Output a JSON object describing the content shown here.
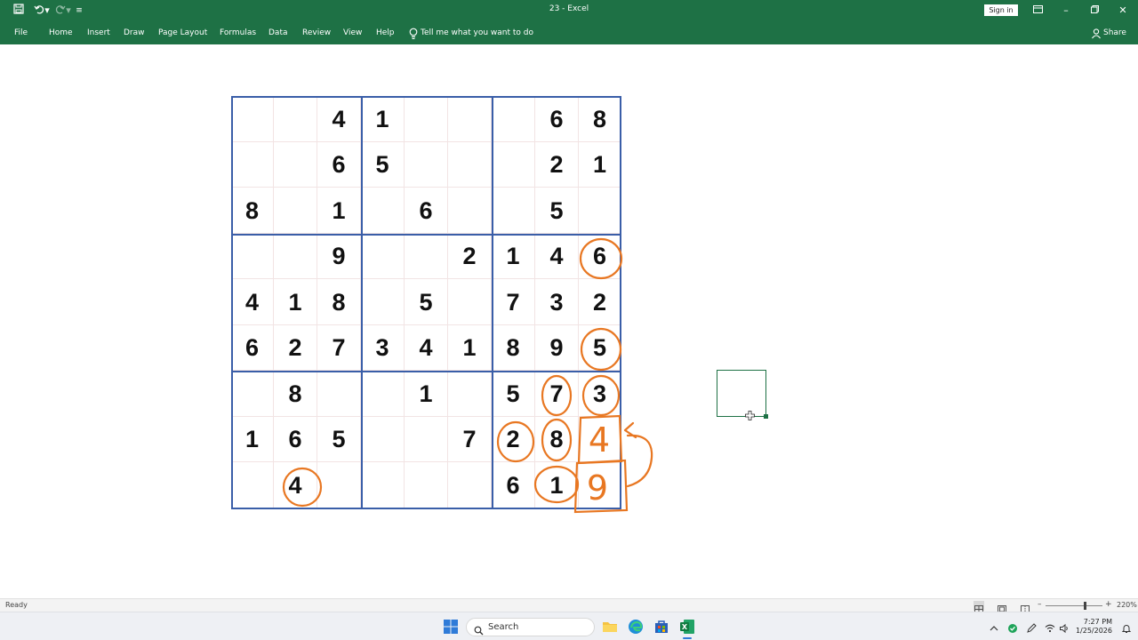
{
  "window": {
    "title": "23  -  Excel",
    "sign_in_label": "Sign in"
  },
  "ribbon": {
    "tabs": [
      "File",
      "Home",
      "Insert",
      "Draw",
      "Page Layout",
      "Formulas",
      "Data",
      "Review",
      "View",
      "Help"
    ],
    "tell_me": "Tell me what you want to do",
    "share": "Share"
  },
  "sudoku": {
    "rows": [
      [
        "",
        "",
        "4",
        "1",
        "",
        "",
        "",
        "6",
        "8"
      ],
      [
        "",
        "",
        "6",
        "5",
        "",
        "",
        "",
        "2",
        "1"
      ],
      [
        "8",
        "",
        "1",
        "",
        "6",
        "",
        "",
        "5",
        ""
      ],
      [
        "",
        "",
        "9",
        "",
        "",
        "2",
        "1",
        "4",
        "6"
      ],
      [
        "4",
        "1",
        "8",
        "",
        "5",
        "",
        "7",
        "3",
        "2"
      ],
      [
        "6",
        "2",
        "7",
        "3",
        "4",
        "1",
        "8",
        "9",
        "5"
      ],
      [
        "",
        "8",
        "",
        "",
        "1",
        "",
        "5",
        "7",
        "3"
      ],
      [
        "1",
        "6",
        "5",
        "",
        "",
        "7",
        "2",
        "8",
        ""
      ],
      [
        "",
        "4",
        "",
        "",
        "",
        "",
        "6",
        "1",
        ""
      ]
    ],
    "annotation_color": "#e87722",
    "handwritten": [
      "4",
      "9"
    ]
  },
  "status": {
    "ready": "Ready",
    "zoom": "220%"
  },
  "taskbar": {
    "search_label": "Search",
    "time": "7:27 PM",
    "date": "1/25/2026"
  },
  "colors": {
    "excel_green": "#1e7145",
    "grid_border": "#3a5ea8"
  }
}
